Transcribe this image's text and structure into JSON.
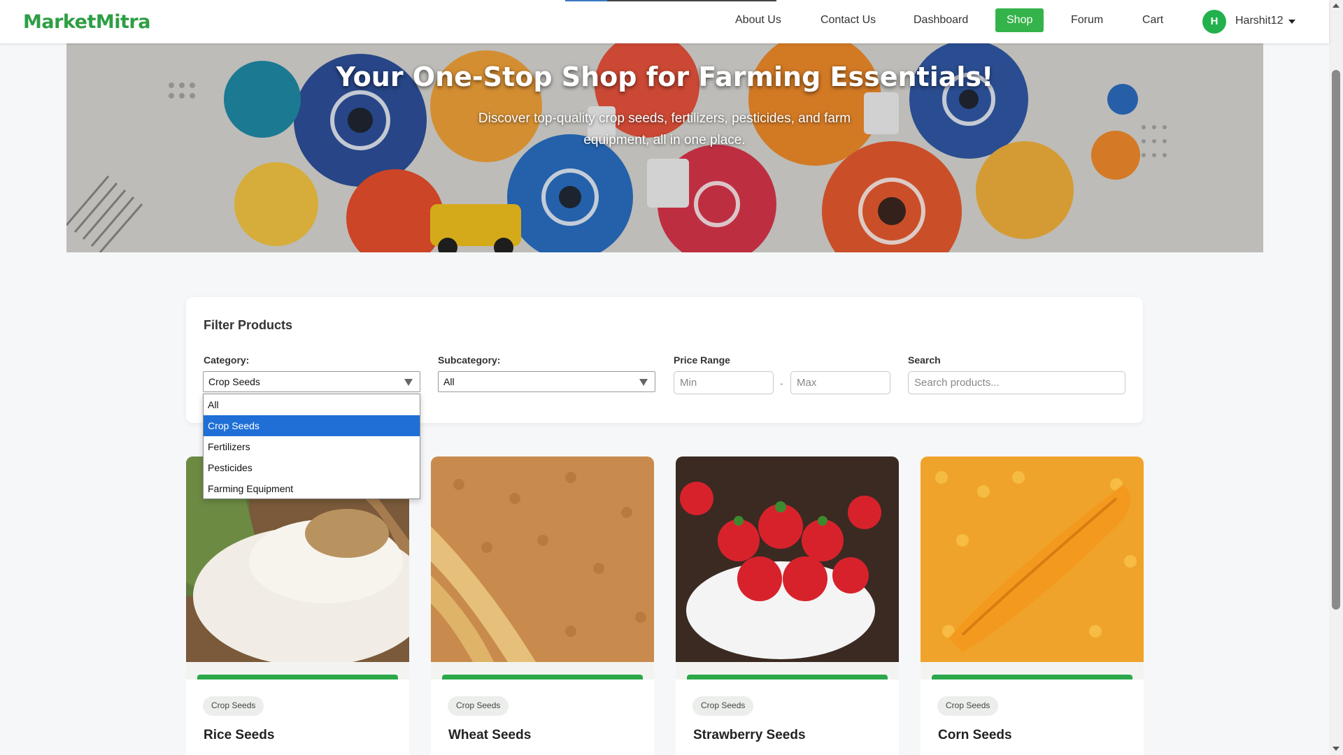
{
  "navbar": {
    "brand": "MarketMitra",
    "links": [
      "About Us",
      "Contact Us",
      "Dashboard",
      "Shop",
      "Forum",
      "Cart"
    ],
    "active_link": "Shop",
    "user_initial": "H",
    "username": "Harshit12",
    "accent_color": "#34b34a"
  },
  "hero": {
    "title": "Your One-Stop Shop for Farming Essentials!",
    "subtitle": "Discover top-quality crop seeds, fertilizers, pesticides, and farm equipment, all in one place."
  },
  "filter": {
    "title": "Filter Products",
    "category_label": "Category:",
    "category_value": "Crop Seeds",
    "category_options": [
      "All",
      "Crop Seeds",
      "Fertilizers",
      "Pesticides",
      "Farming Equipment"
    ],
    "category_selected_index": 1,
    "subcategory_label": "Subcategory:",
    "subcategory_value": "All",
    "price_label": "Price Range",
    "price_min_placeholder": "Min",
    "price_max_placeholder": "Max",
    "price_separator": "-",
    "search_label": "Search",
    "search_placeholder": "Search products..."
  },
  "products": [
    {
      "name": "Rice Seeds",
      "tag": "Crop Seeds"
    },
    {
      "name": "Wheat Seeds",
      "tag": "Crop Seeds"
    },
    {
      "name": "Strawberry Seeds",
      "tag": "Crop Seeds"
    },
    {
      "name": "Corn Seeds",
      "tag": "Crop Seeds"
    }
  ]
}
